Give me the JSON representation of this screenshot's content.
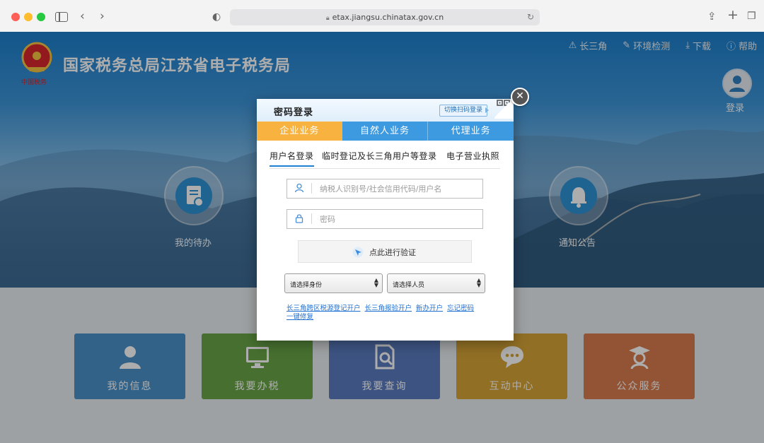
{
  "browser": {
    "url": "etax.jiangsu.chinatax.gov.cn"
  },
  "header": {
    "site_title": "国家税务总局江苏省电子税务局",
    "links": [
      {
        "label": "长三角",
        "icon": "triangle-network-icon"
      },
      {
        "label": "环境检测",
        "icon": "wrench-icon"
      },
      {
        "label": "下载",
        "icon": "download-icon"
      },
      {
        "label": "帮助",
        "icon": "help-icon"
      }
    ],
    "login_label": "登录"
  },
  "quick": {
    "todo_label": "我的待办",
    "notice_label": "通知公告"
  },
  "tiles": [
    {
      "label": "我的信息",
      "color": "#4a91c8",
      "icon": "user-icon"
    },
    {
      "label": "我要办税",
      "color": "#69a648",
      "icon": "monitor-icon"
    },
    {
      "label": "我要查询",
      "color": "#5a7cc0",
      "icon": "search-doc-icon"
    },
    {
      "label": "互动中心",
      "color": "#d6a437",
      "icon": "chat-icon"
    },
    {
      "label": "公众服务",
      "color": "#d77d4f",
      "icon": "graduate-icon"
    }
  ],
  "modal": {
    "title": "密码登录",
    "switch_qr_label": "切换扫码登录",
    "business_tabs": [
      "企业业务",
      "自然人业务",
      "代理业务"
    ],
    "login_tabs": [
      "用户名登录",
      "临时登记及长三角用户等登录",
      "电子营业执照"
    ],
    "username_placeholder": "纳税人识别号/社会信用代码/用户名",
    "password_placeholder": "密码",
    "verify_label": "点此进行验证",
    "identity_select": "请选择身份",
    "person_select": "请选择人员",
    "links": [
      "长三角跨区税源登记开户",
      "长三角报验开户",
      "新办开户",
      "忘记密码",
      "一键修复"
    ]
  },
  "colors": {
    "accent_orange": "#f7b23f",
    "accent_blue": "#3d9ae0"
  }
}
